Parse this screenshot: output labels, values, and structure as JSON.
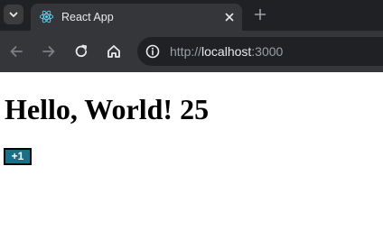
{
  "browser": {
    "tab": {
      "title": "React App",
      "favicon": "react-logo-icon"
    },
    "toolbar": {
      "back_icon": "arrow-left-icon",
      "forward_icon": "arrow-right-icon",
      "reload_icon": "reload-icon",
      "home_icon": "home-icon",
      "site_info_icon": "info-icon"
    },
    "address": {
      "scheme": "http://",
      "host": "localhost",
      "port": ":3000"
    },
    "colors": {
      "frame": "#202124",
      "tab_active": "#35363a",
      "omnibox": "#202124",
      "react_blue": "#61dafb"
    }
  },
  "page": {
    "heading": "Hello, World! 25",
    "increment_button": {
      "label": "+1",
      "color": "#1a6e86"
    }
  }
}
